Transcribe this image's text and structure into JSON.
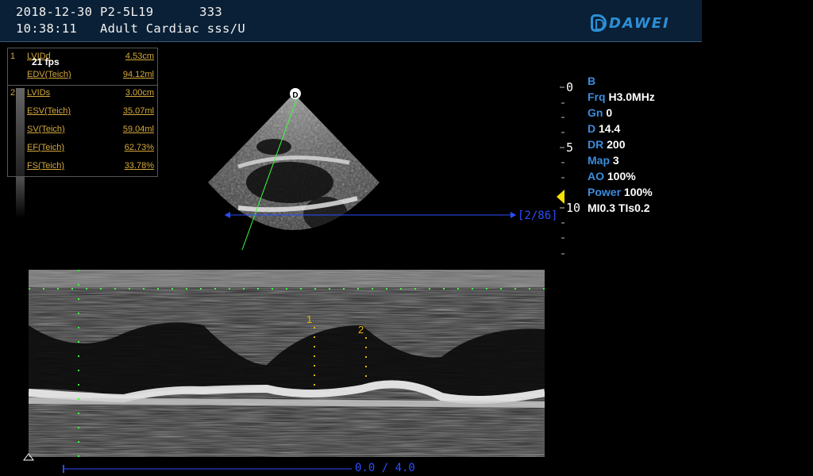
{
  "header": {
    "line1": "2018-12-30 P2-5L19      333",
    "line2": "10:38:11   Adult Cardiac sss/U",
    "logo_text": "DAWEI"
  },
  "fps": "21 fps",
  "measurements": [
    {
      "index": "1",
      "label": "LVIDd",
      "value": "4.53cm"
    },
    {
      "index": "",
      "label": "EDV(Teich)",
      "value": "94.12ml"
    },
    {
      "index": "2",
      "label": "LVIDs",
      "value": "3.00cm"
    },
    {
      "index": "",
      "label": "ESV(Teich)",
      "value": "35.07ml"
    },
    {
      "index": "",
      "label": "SV(Teich)",
      "value": "59.04ml"
    },
    {
      "index": "",
      "label": "EF(Teich)",
      "value": "62.73%"
    },
    {
      "index": "",
      "label": "FS(Teich)",
      "value": "33.78%"
    }
  ],
  "depth_scale": [
    "0",
    "5",
    "10"
  ],
  "frame_counter": "[2/86]",
  "params": [
    {
      "key": "B",
      "value": ""
    },
    {
      "key": "Frq",
      "value": "H3.0MHz"
    },
    {
      "key": "Gn",
      "value": "0"
    },
    {
      "key": "D",
      "value": "14.4"
    },
    {
      "key": "DR",
      "value": "200"
    },
    {
      "key": "Map",
      "value": "3"
    },
    {
      "key": "AO",
      "value": "100%"
    },
    {
      "key": "Power",
      "value": "100%"
    },
    {
      "key": "MI0.3",
      "value": "TIs0.2"
    }
  ],
  "mmode": {
    "cine_text": "0.0 / 4.0",
    "caliper_labels": [
      "1",
      "2"
    ]
  },
  "colors": {
    "header_bg": "#0a2036",
    "measure_text": "#d4a83c",
    "param_key": "#3a8cdc",
    "m_line": "#2b4dff",
    "caliper": "#e6b800",
    "guide_line": "#3cff3c"
  }
}
